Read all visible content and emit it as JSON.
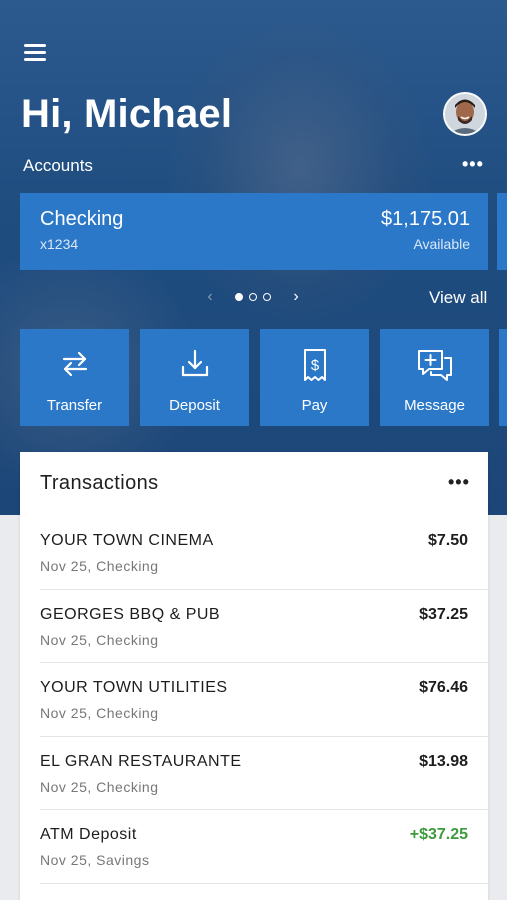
{
  "greeting": "Hi, Michael",
  "accounts_label": "Accounts",
  "more_glyph": "•••",
  "account": {
    "name": "Checking",
    "number": "x1234",
    "balance": "$1,175.01",
    "balance_label": "Available"
  },
  "pager": {
    "prev": "‹",
    "next": "›",
    "current_page": 1,
    "total_pages": 3
  },
  "view_all": "View all",
  "actions": [
    {
      "label": "Transfer",
      "icon": "transfer-icon"
    },
    {
      "label": "Deposit",
      "icon": "deposit-icon"
    },
    {
      "label": "Pay",
      "icon": "pay-icon"
    },
    {
      "label": "Message",
      "icon": "message-icon"
    }
  ],
  "transactions": {
    "title": "Transactions",
    "items": [
      {
        "merchant": "YOUR TOWN CINEMA",
        "meta": "Nov 25, Checking",
        "amount": "$7.50"
      },
      {
        "merchant": "GEORGES BBQ & PUB",
        "meta": "Nov 25, Checking",
        "amount": "$37.25"
      },
      {
        "merchant": "YOUR TOWN UTILITIES",
        "meta": "Nov 25, Checking",
        "amount": "$76.46"
      },
      {
        "merchant": "EL GRAN RESTAURANTE",
        "meta": "Nov 25, Checking",
        "amount": "$13.98"
      },
      {
        "merchant": "ATM Deposit",
        "meta": "Nov 25, Savings",
        "amount": "+$37.25"
      }
    ]
  },
  "colors": {
    "header_bg": "#1f4d80",
    "tile_blue": "#2b78c9",
    "credit_green": "#3d9a3d"
  }
}
